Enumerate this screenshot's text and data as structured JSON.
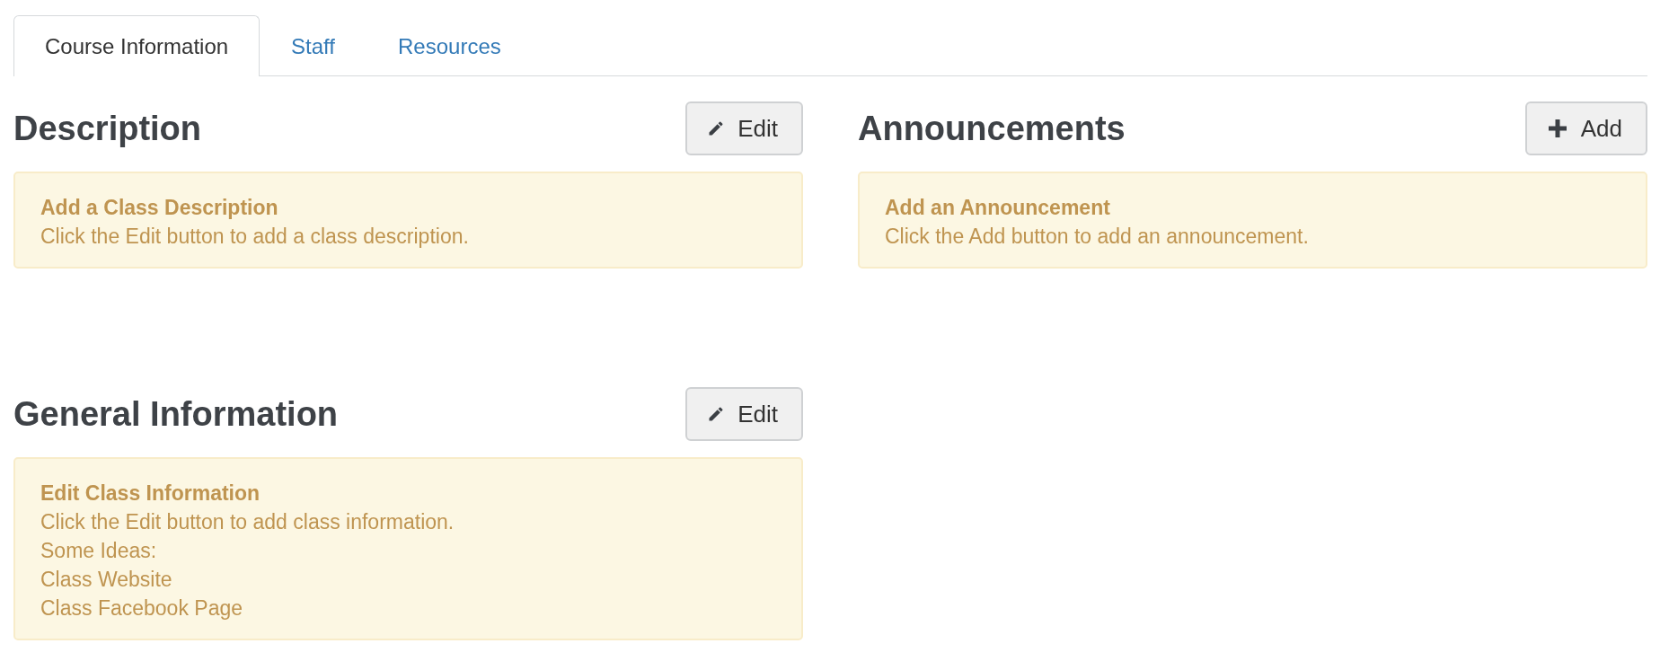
{
  "tabs": [
    {
      "label": "Course Information",
      "selected": true
    },
    {
      "label": "Staff",
      "selected": false
    },
    {
      "label": "Resources",
      "selected": false
    }
  ],
  "columns": [
    {
      "sections": [
        {
          "heading": "Description",
          "button": {
            "kind": "edit",
            "label": "Edit"
          },
          "notice": {
            "title": "Add a Class Description",
            "lines": [
              "Click the Edit button to add a class description."
            ]
          }
        },
        {
          "heading": "General Information",
          "button": {
            "kind": "edit",
            "label": "Edit"
          },
          "notice": {
            "title": "Edit Class Information",
            "lines": [
              "Click the Edit button to add class information.",
              "Some Ideas:",
              "Class Website",
              "Class Facebook Page"
            ]
          }
        }
      ]
    },
    {
      "sections": [
        {
          "heading": "Announcements",
          "button": {
            "kind": "add",
            "label": "Add"
          },
          "notice": {
            "title": "Add an Announcement",
            "lines": [
              "Click the Add button to add an announcement."
            ]
          }
        }
      ]
    }
  ]
}
